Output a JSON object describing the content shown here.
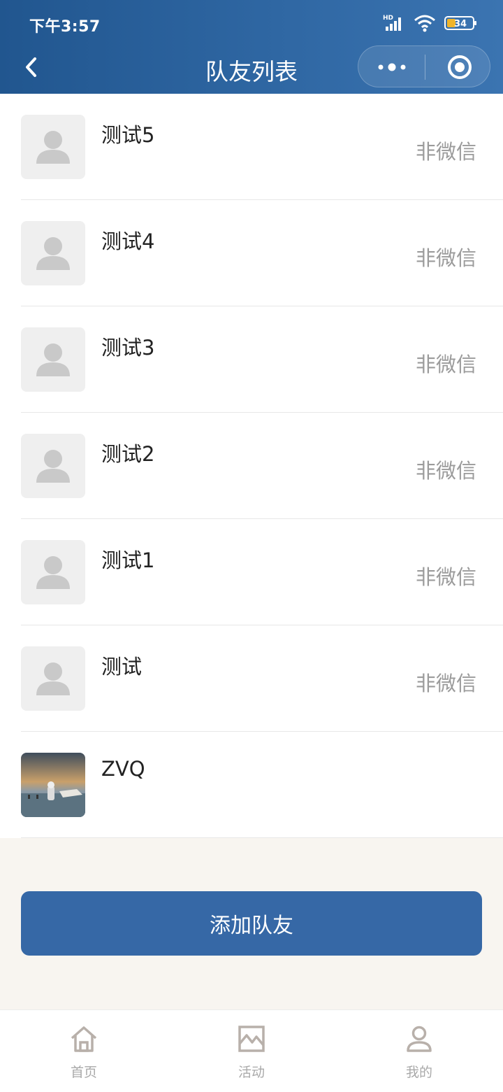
{
  "status_bar": {
    "time": "下午3:57",
    "network": "HD",
    "battery": "34"
  },
  "nav": {
    "title": "队友列表"
  },
  "teammates": [
    {
      "name": "测试5",
      "tag": "非微信",
      "avatar": "placeholder"
    },
    {
      "name": "测试4",
      "tag": "非微信",
      "avatar": "placeholder"
    },
    {
      "name": "测试3",
      "tag": "非微信",
      "avatar": "placeholder"
    },
    {
      "name": "测试2",
      "tag": "非微信",
      "avatar": "placeholder"
    },
    {
      "name": "测试1",
      "tag": "非微信",
      "avatar": "placeholder"
    },
    {
      "name": "测试",
      "tag": "非微信",
      "avatar": "placeholder"
    },
    {
      "name": "ZVQ",
      "tag": "",
      "avatar": "photo"
    }
  ],
  "actions": {
    "add_label": "添加队友"
  },
  "tabbar": {
    "items": [
      {
        "label": "首页",
        "icon": "home-icon"
      },
      {
        "label": "活动",
        "icon": "activity-icon"
      },
      {
        "label": "我的",
        "icon": "profile-icon"
      }
    ]
  },
  "colors": {
    "header": "#2a5f9c",
    "button": "#3668a6",
    "background": "#f8f5f0"
  }
}
